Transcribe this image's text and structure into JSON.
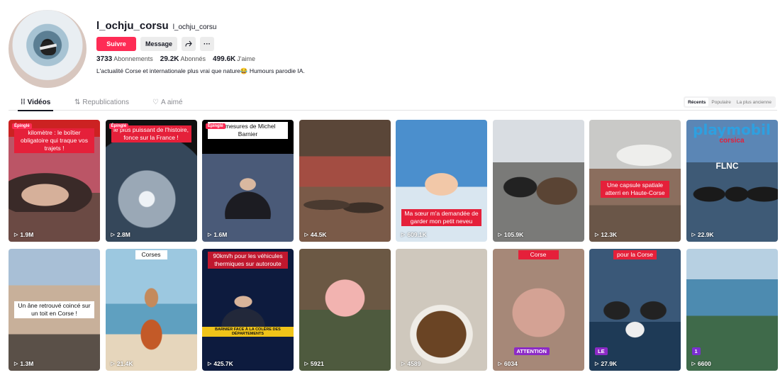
{
  "profile": {
    "username": "l_ochju_corsu",
    "handle": "l_ochju_corsu",
    "follow_label": "Suivre",
    "message_label": "Message",
    "share_icon": "share-icon",
    "more_icon": "more-icon",
    "following_count": "3733",
    "following_label": "Abonnements",
    "followers_count": "29.2K",
    "followers_label": "Abonnés",
    "likes_count": "499.6K",
    "likes_label": "J'aime",
    "bio": "L'actualité Corse et internationale plus vrai que nature😂 Humours parodie IA."
  },
  "tabs": [
    {
      "label": "Vidéos",
      "icon": "grid-icon"
    },
    {
      "label": "Republications",
      "icon": "repost-icon"
    },
    {
      "label": "A aimé",
      "icon": "heart-icon"
    }
  ],
  "sort": [
    "Récents",
    "Populaire",
    "La plus ancienne"
  ],
  "videos": [
    {
      "views": "1.9M",
      "pinned": "Épinglé",
      "caption": "kilomètre : le boîtier obligatoire qui traque vos trajets !",
      "bg": "#7a5850"
    },
    {
      "views": "2.8M",
      "pinned": "Épinglé",
      "caption": "le plus puissant de l'histoire, fonce sur la France !",
      "bg": "#52606c"
    },
    {
      "views": "1.6M",
      "pinned": "Épinglé",
      "caption": "s mesures de Michel Barnier",
      "bg": "#2a3040"
    },
    {
      "views": "44.5K",
      "caption": "",
      "bg": "#6a4a3a"
    },
    {
      "views": "609.1K",
      "caption": "Ma sœur m'a demandée de garder mon petit neveu",
      "bg": "#4a86b8"
    },
    {
      "views": "105.9K",
      "caption": "",
      "bg": "#6c6c6a"
    },
    {
      "views": "12.3K",
      "caption": "Une capsule spatiale atterri en Haute-Corse",
      "bg": "#8a8a88"
    },
    {
      "views": "22.9K",
      "caption": "FLNC",
      "bg": "#4a6a88",
      "title": "playmobil",
      "subtitle": "corsica"
    },
    {
      "views": "1.3M",
      "caption": "Un âne retrouvé coincé sur un toit en Corse !",
      "bg": "#8aa2bd"
    },
    {
      "views": "21.4K",
      "caption": "Corses",
      "bg": "#7fb2cc"
    },
    {
      "views": "425.7K",
      "caption": "90km/h pour les véhicules thermiques sur autoroute",
      "ticker": "BARNIER FACE À LA COLÈRE DES DÉPARTEMENTS",
      "bg": "#1d2a55"
    },
    {
      "views": "5921",
      "caption": "",
      "bg": "#6f5b46"
    },
    {
      "views": "4589",
      "caption": "",
      "bg": "#c8c0b4"
    },
    {
      "views": "6034",
      "caption": "Corse",
      "tag": "ATTENTION",
      "bg": "#b08f85"
    },
    {
      "views": "27.9K",
      "caption": "pour la Corse",
      "tag": "LE",
      "bg": "#39546e"
    },
    {
      "views": "6600",
      "caption": "",
      "tag": "1",
      "bg": "#5c89a8"
    }
  ]
}
